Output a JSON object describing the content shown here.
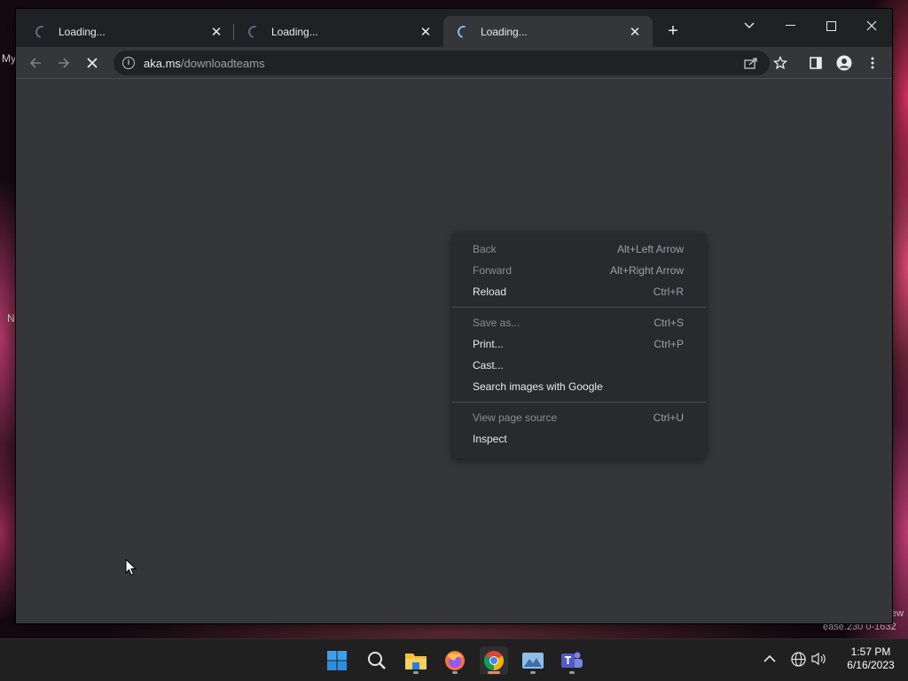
{
  "desktop": {
    "fragment_my": "My",
    "fragment_n": "N",
    "fragment_ew": "ew",
    "fragment_build": "ease.230 0-1632"
  },
  "tabs": [
    {
      "title": "Loading...",
      "close": "✕"
    },
    {
      "title": "Loading...",
      "close": "✕"
    },
    {
      "title": "Loading...",
      "close": "✕"
    }
  ],
  "new_tab": "+",
  "window_controls": {
    "tab_search": "⌄",
    "minimize": "—",
    "maximize": "☐",
    "close": "✕"
  },
  "address": {
    "host": "aka.ms",
    "path": "/downloadteams"
  },
  "context_menu": {
    "back": {
      "label": "Back",
      "shortcut": "Alt+Left Arrow"
    },
    "forward": {
      "label": "Forward",
      "shortcut": "Alt+Right Arrow"
    },
    "reload": {
      "label": "Reload",
      "shortcut": "Ctrl+R"
    },
    "save_as": {
      "label": "Save as...",
      "shortcut": "Ctrl+S"
    },
    "print": {
      "label": "Print...",
      "shortcut": "Ctrl+P"
    },
    "cast": {
      "label": "Cast..."
    },
    "search_images": {
      "label": "Search images with Google"
    },
    "view_source": {
      "label": "View page source",
      "shortcut": "Ctrl+U"
    },
    "inspect": {
      "label": "Inspect"
    }
  },
  "taskbar": {
    "time": "1:57 PM",
    "date": "6/16/2023",
    "apps": [
      "start-icon",
      "search-icon",
      "file-explorer-icon",
      "firefox-icon",
      "chrome-icon",
      "photos-icon",
      "teams-icon"
    ]
  },
  "colors": {
    "accent": "#8ab4f8",
    "menu_bg": "#292a2d",
    "content_bg": "#35363a",
    "titlebar_bg": "#202124"
  }
}
